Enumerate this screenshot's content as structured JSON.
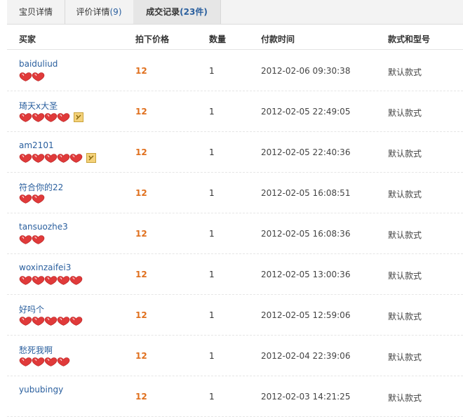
{
  "tabs": [
    {
      "label": "宝贝详情",
      "count": ""
    },
    {
      "label": "评价详情",
      "count": "(9)"
    },
    {
      "label": "成交记录",
      "count": "(23件)"
    }
  ],
  "headers": {
    "buyer": "买家",
    "price": "拍下价格",
    "qty": "数量",
    "time": "付款时间",
    "style": "款式和型号"
  },
  "rows": [
    {
      "buyer": "baiduliud",
      "hearts": 2,
      "vip": false,
      "price": "12",
      "qty": "1",
      "time": "2012-02-06 09:30:38",
      "style": "默认款式"
    },
    {
      "buyer": "琦天x大圣",
      "hearts": 4,
      "vip": true,
      "price": "12",
      "qty": "1",
      "time": "2012-02-05 22:49:05",
      "style": "默认款式"
    },
    {
      "buyer": "am2101",
      "hearts": 5,
      "vip": true,
      "price": "12",
      "qty": "1",
      "time": "2012-02-05 22:40:36",
      "style": "默认款式"
    },
    {
      "buyer": "符合你的22",
      "hearts": 2,
      "vip": false,
      "price": "12",
      "qty": "1",
      "time": "2012-02-05 16:08:51",
      "style": "默认款式"
    },
    {
      "buyer": "tansuozhe3",
      "hearts": 2,
      "vip": false,
      "price": "12",
      "qty": "1",
      "time": "2012-02-05 16:08:36",
      "style": "默认款式"
    },
    {
      "buyer": "woxinzaifei3",
      "hearts": 5,
      "vip": false,
      "price": "12",
      "qty": "1",
      "time": "2012-02-05 13:00:36",
      "style": "默认款式"
    },
    {
      "buyer": "好吗个",
      "hearts": 5,
      "vip": false,
      "price": "12",
      "qty": "1",
      "time": "2012-02-05 12:59:06",
      "style": "默认款式"
    },
    {
      "buyer": "愁死我啊",
      "hearts": 4,
      "vip": false,
      "price": "12",
      "qty": "1",
      "time": "2012-02-04 22:39:06",
      "style": "默认款式"
    },
    {
      "buyer": "yububingy",
      "hearts": 0,
      "vip": false,
      "price": "12",
      "qty": "1",
      "time": "2012-02-03 14:21:25",
      "style": "默认款式"
    }
  ],
  "colors": {
    "buyer_link": "#2a5f9e",
    "price": "#e0701e",
    "heart": "#e03a3a"
  },
  "icons": {
    "rank": "heart-rank-icon",
    "vip": "vip-badge-icon"
  }
}
